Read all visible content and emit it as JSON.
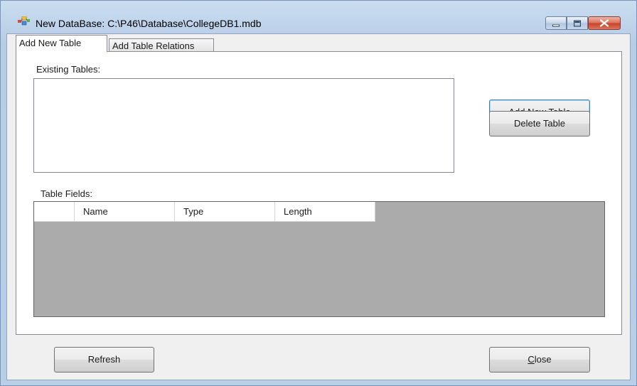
{
  "window": {
    "title": "New DataBase: C:\\P46\\Database\\CollegeDB1.mdb",
    "icon": "database-app-icon",
    "controls": {
      "minimize": "minimize-icon",
      "maximize": "maximize-icon",
      "close": "close-icon"
    }
  },
  "tabs": [
    {
      "label": "Add New Table",
      "active": true
    },
    {
      "label": "Add Table Relations",
      "active": false
    }
  ],
  "existing_tables": {
    "label": "Existing Tables:",
    "items": []
  },
  "buttons": {
    "add_new_table": "Add New Table",
    "delete_table": "Delete Table"
  },
  "table_fields": {
    "label": "Table Fields:",
    "columns": [
      "",
      "Name",
      "Type",
      "Length"
    ],
    "rows": []
  },
  "footer": {
    "refresh": "Refresh",
    "close_mnemonic": "C",
    "close_rest": "lose"
  },
  "colors": {
    "grid_background": "#ababab",
    "title_bar": "#c9dcf0",
    "close_button": "#c8412a"
  }
}
